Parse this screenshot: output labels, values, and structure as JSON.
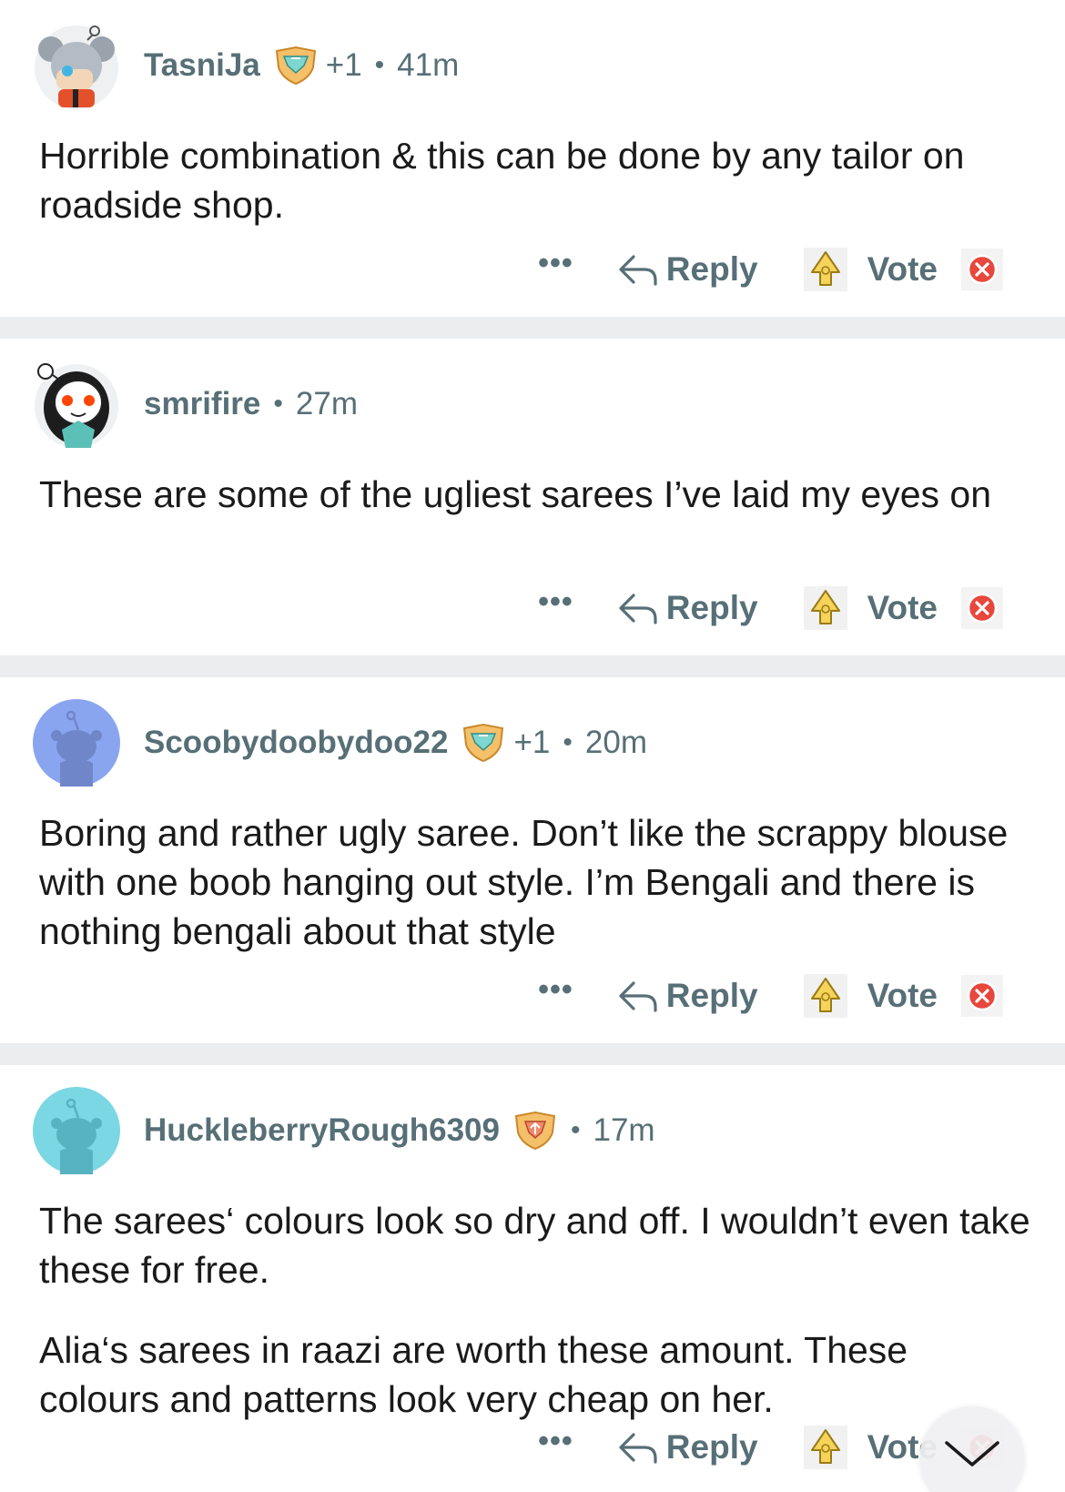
{
  "comments": [
    {
      "username": "TasniJa",
      "award_count": "+1",
      "time": "41m",
      "body": [
        "Horrible combination & this can be done by any tailor on roadside shop."
      ],
      "more_label": "•••",
      "reply_label": "Reply",
      "vote_label": "Vote"
    },
    {
      "username": "smrifire",
      "award_count": "",
      "time": "27m",
      "body": [
        "These are some of the ugliest sarees I’ve laid my eyes on"
      ],
      "more_label": "•••",
      "reply_label": "Reply",
      "vote_label": "Vote"
    },
    {
      "username": "Scoobydoobydoo22",
      "award_count": "+1",
      "time": "20m",
      "body": [
        "Boring and rather ugly saree. Don’t like the scrappy blouse with one boob hanging out style. I’m Bengali and there is nothing bengali about that style"
      ],
      "more_label": "•••",
      "reply_label": "Reply",
      "vote_label": "Vote"
    },
    {
      "username": "HuckleberryRough6309",
      "award_count": "",
      "time": "17m",
      "body": [
        "The sarees‘ colours look so dry and off. I wouldn’t even take these for free.",
        "Alia‘s sarees in raazi are worth these amount. These colours and patterns look very cheap on her."
      ],
      "more_label": "•••",
      "reply_label": "Reply",
      "vote_label": "Vote"
    }
  ],
  "separator": "•",
  "colors": {
    "meta_text": "#576f76",
    "body_text": "#1a1a1b",
    "divider": "#ebedef",
    "downvote_red": "#e8473d",
    "avatar_blue": "#8aa5f0",
    "avatar_cyan": "#7ad7e3"
  },
  "icons": {
    "award": "shield-award-icon",
    "reply": "reply-arrow-icon",
    "vote": "gold-upvote-icon",
    "close": "red-x-icon",
    "scroll": "chevron-down-icon"
  }
}
